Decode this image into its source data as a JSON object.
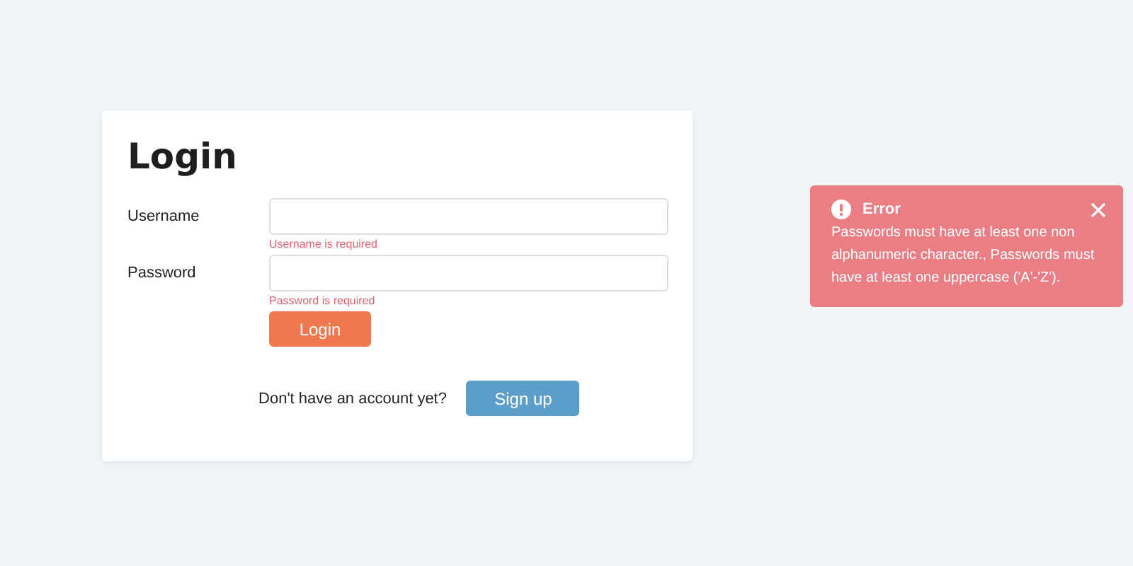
{
  "login_form": {
    "title": "Login",
    "fields": [
      {
        "label": "Username",
        "error": "Username is required"
      },
      {
        "label": "Password",
        "error": "Password is required"
      }
    ],
    "submit_button": "Login",
    "signup_prompt": "Don't have an account yet?",
    "signup_button": "Sign up"
  },
  "toast": {
    "title": "Error",
    "message": "Passwords must have at least one non alphanumeric character., Passwords must have at least one uppercase ('A'-'Z')."
  }
}
